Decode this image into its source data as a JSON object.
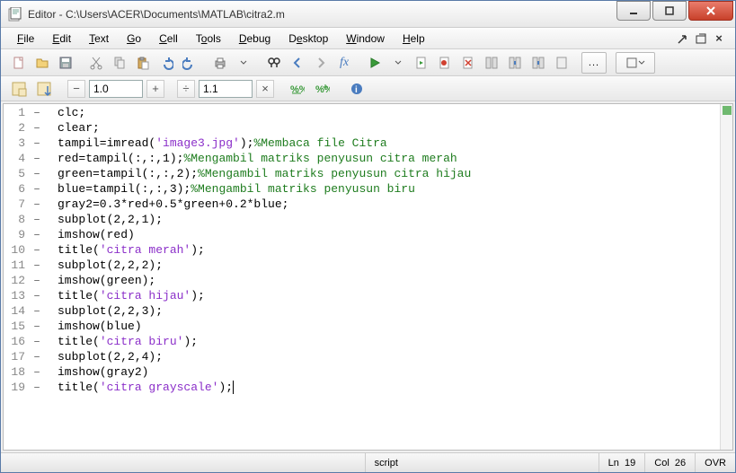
{
  "window": {
    "title": "Editor - C:\\Users\\ACER\\Documents\\MATLAB\\citra2.m"
  },
  "menu": {
    "file": "File",
    "edit": "Edit",
    "text": "Text",
    "go": "Go",
    "cell": "Cell",
    "tools": "Tools",
    "debug": "Debug",
    "desktop": "Desktop",
    "window": "Window",
    "help": "Help"
  },
  "toolbar2": {
    "field1": "1.0",
    "field2": "1.1"
  },
  "code": {
    "lines": [
      {
        "n": "1",
        "d": "–",
        "pre": "clc;"
      },
      {
        "n": "2",
        "d": "–",
        "pre": "clear;"
      },
      {
        "n": "3",
        "d": "–",
        "pre": "tampil=imread(",
        "s": "'image3.jpg'",
        "mid": ");",
        "c": "%Membaca file Citra"
      },
      {
        "n": "4",
        "d": "–",
        "pre": "red=tampil(:,:,1);",
        "c": "%Mengambil matriks penyusun citra merah"
      },
      {
        "n": "5",
        "d": "–",
        "pre": "green=tampil(:,:,2);",
        "c": "%Mengambil matriks penyusun citra hijau"
      },
      {
        "n": "6",
        "d": "–",
        "pre": "blue=tampil(:,:,3);",
        "c": "%Mengambil matriks penyusun biru"
      },
      {
        "n": "7",
        "d": "–",
        "pre": "gray2=0.3*red+0.5*green+0.2*blue;"
      },
      {
        "n": "8",
        "d": "–",
        "pre": "subplot(2,2,1);"
      },
      {
        "n": "9",
        "d": "–",
        "pre": "imshow(red)"
      },
      {
        "n": "10",
        "d": "–",
        "pre": "title(",
        "s": "'citra merah'",
        "mid": ");"
      },
      {
        "n": "11",
        "d": "–",
        "pre": "subplot(2,2,2);"
      },
      {
        "n": "12",
        "d": "–",
        "pre": "imshow(green);"
      },
      {
        "n": "13",
        "d": "–",
        "pre": "title(",
        "s": "'citra hijau'",
        "mid": ");"
      },
      {
        "n": "14",
        "d": "–",
        "pre": "subplot(2,2,3);"
      },
      {
        "n": "15",
        "d": "–",
        "pre": "imshow(blue)"
      },
      {
        "n": "16",
        "d": "–",
        "pre": "title(",
        "s": "'citra biru'",
        "mid": ");"
      },
      {
        "n": "17",
        "d": "–",
        "pre": "subplot(2,2,4);"
      },
      {
        "n": "18",
        "d": "–",
        "pre": "imshow(gray2)"
      },
      {
        "n": "19",
        "d": "–",
        "pre": "title(",
        "s": "'citra grayscale'",
        "mid": ");",
        "cur": true
      }
    ]
  },
  "status": {
    "type": "script",
    "ln_label": "Ln",
    "ln": "19",
    "col_label": "Col",
    "col": "26",
    "ovr": "OVR"
  }
}
